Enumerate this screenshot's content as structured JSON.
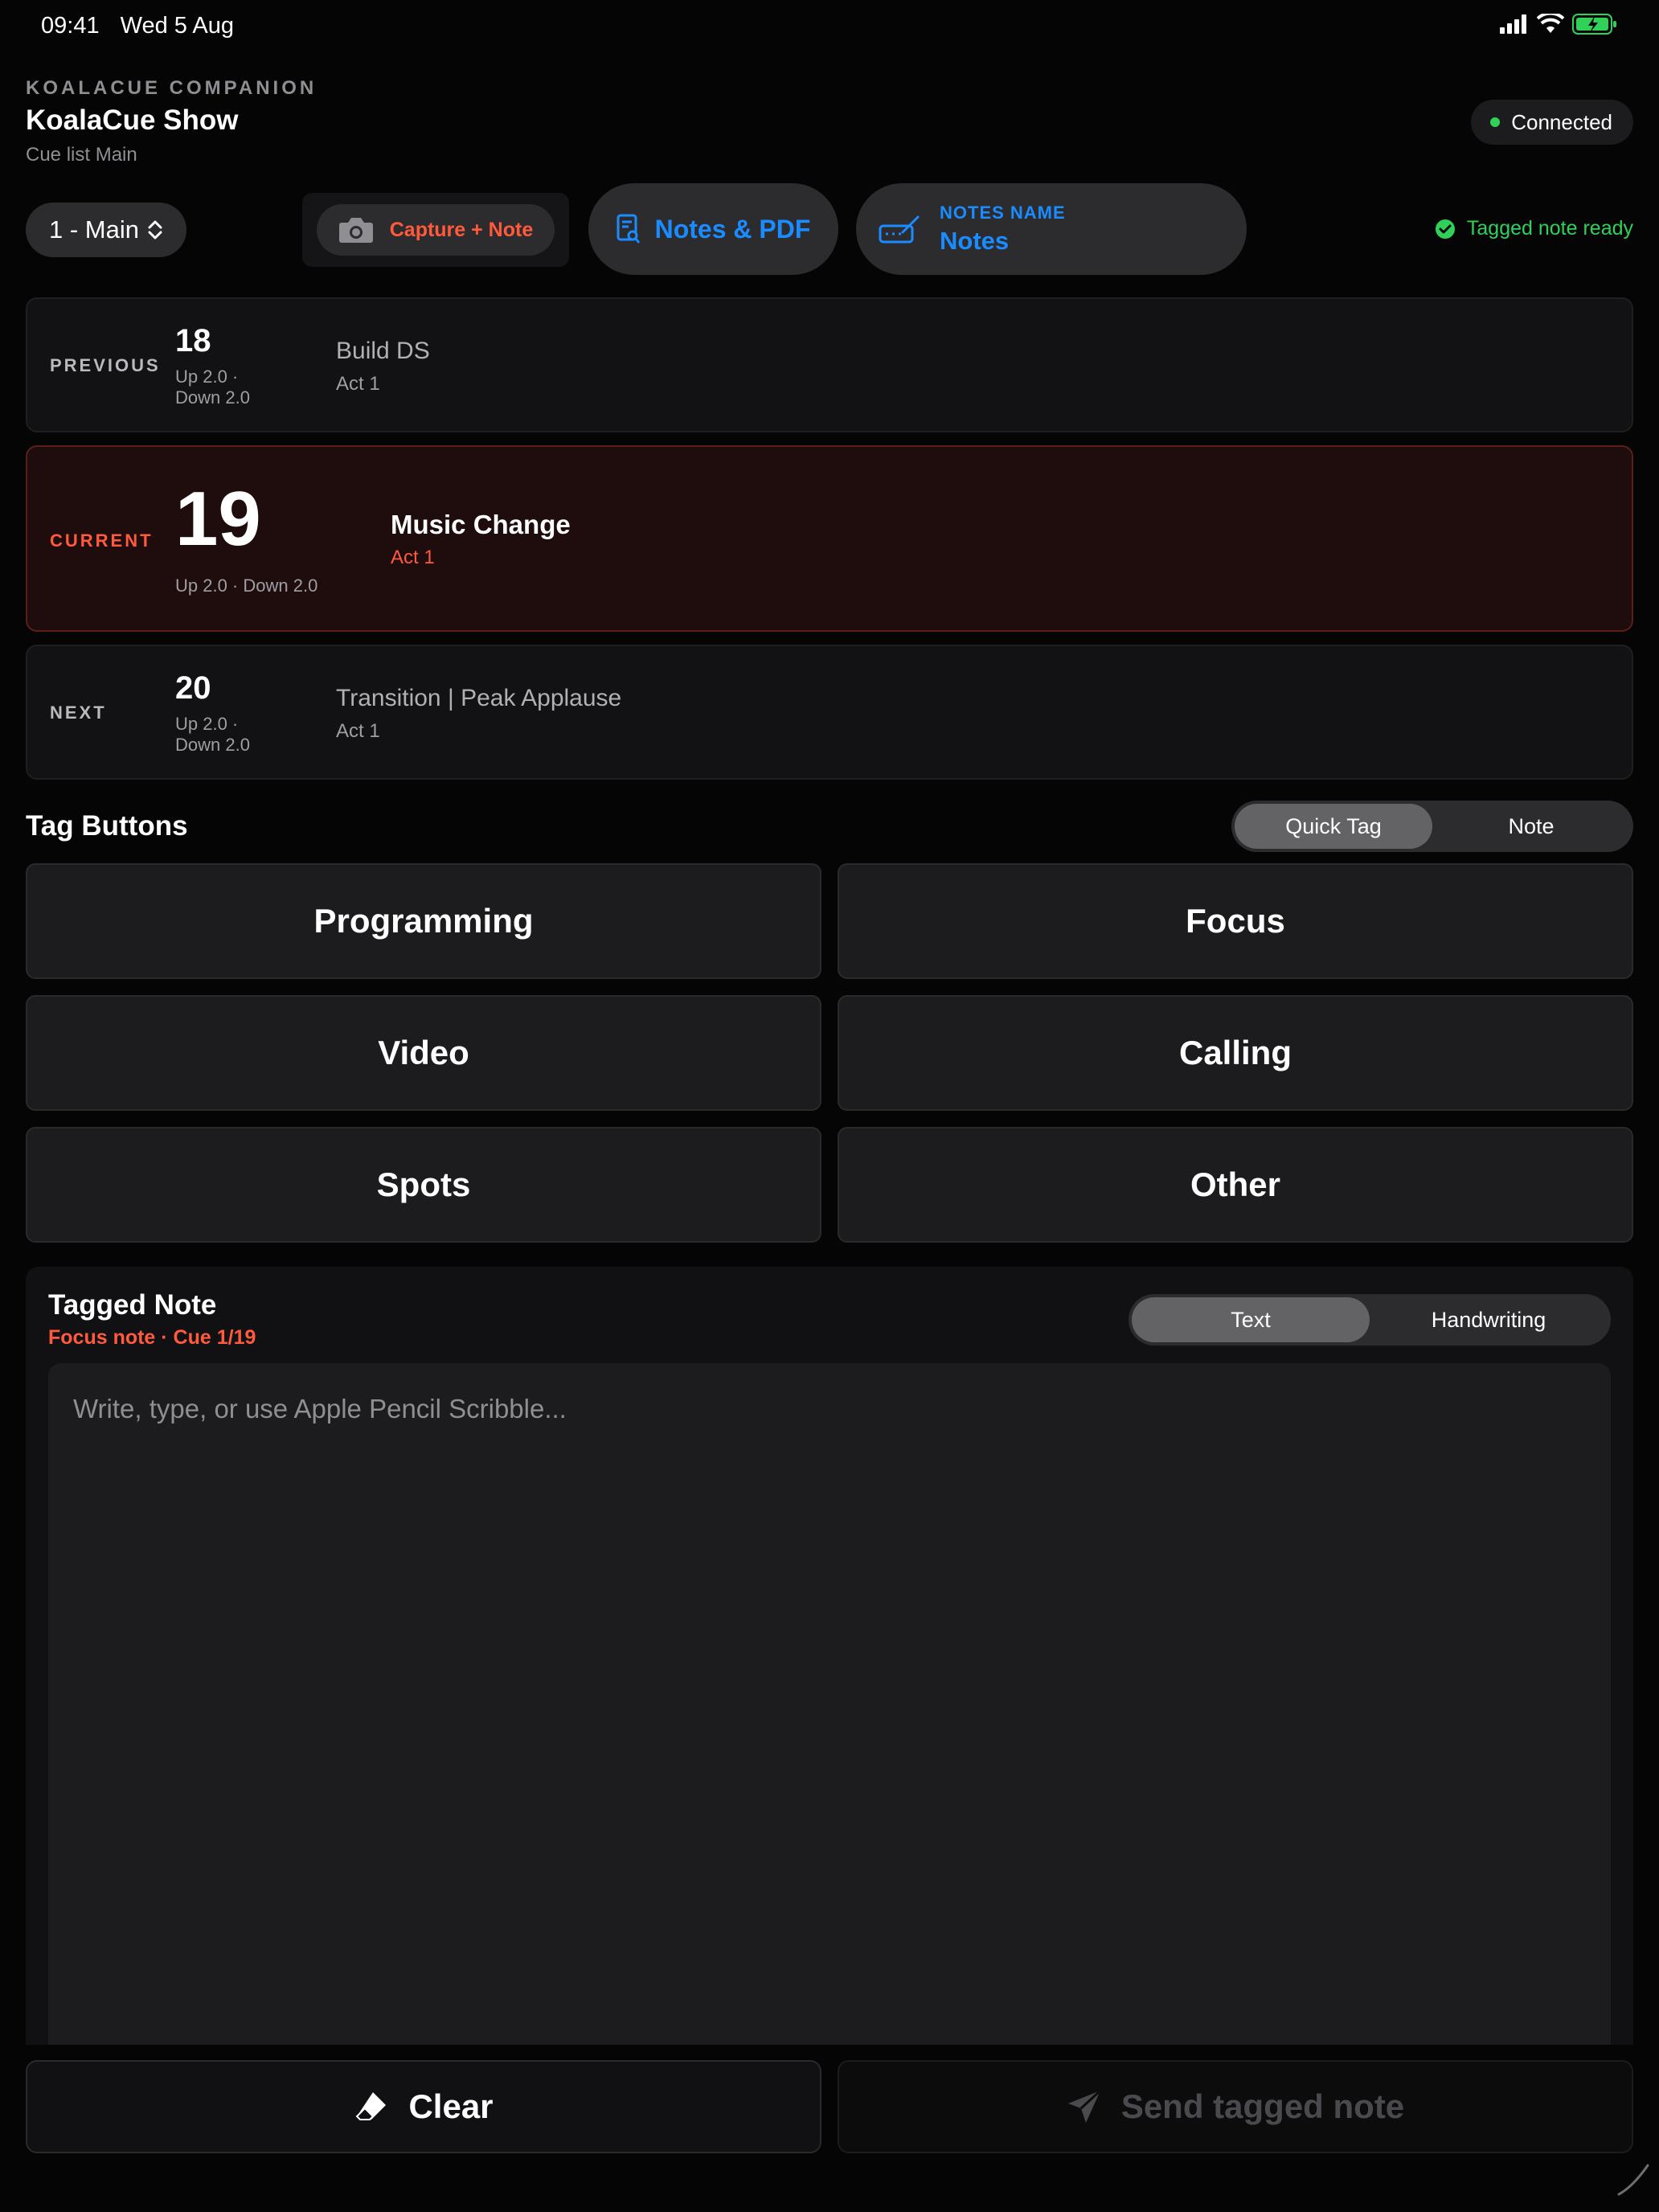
{
  "status_bar": {
    "time": "09:41",
    "date": "Wed 5 Aug"
  },
  "header": {
    "kicker": "KOALACUE COMPANION",
    "title": "KoalaCue Show",
    "subtitle": "Cue list Main",
    "connection": "Connected"
  },
  "toolbar": {
    "cue_list": "1 - Main",
    "capture_label": "Capture + Note",
    "notes_pdf_label": "Notes & PDF",
    "notes_name_kicker": "NOTES NAME",
    "notes_name_value": "Notes",
    "tag_status": "Tagged note ready"
  },
  "cues": {
    "previous": {
      "label": "PREVIOUS",
      "number": "18",
      "meta_1": "Up 2.0 ·",
      "meta_2": "Down 2.0",
      "name": "Build DS",
      "act": "Act 1"
    },
    "current": {
      "label": "CURRENT",
      "number": "19",
      "meta": "Up 2.0 · Down 2.0",
      "name": "Music Change",
      "act": "Act 1"
    },
    "next": {
      "label": "NEXT",
      "number": "20",
      "meta_1": "Up 2.0 ·",
      "meta_2": "Down 2.0",
      "name": "Transition | Peak Applause",
      "act": "Act 1"
    }
  },
  "tags": {
    "title": "Tag Buttons",
    "mode_options": [
      "Quick Tag",
      "Note"
    ],
    "mode_selected": "Quick Tag",
    "buttons": [
      "Programming",
      "Focus",
      "Video",
      "Calling",
      "Spots",
      "Other"
    ]
  },
  "tagged_note": {
    "title": "Tagged Note",
    "subtitle": "Focus note · Cue 1/19",
    "input_options": [
      "Text",
      "Handwriting"
    ],
    "input_selected": "Text",
    "placeholder": "Write, type, or use Apple Pencil Scribble...",
    "value": ""
  },
  "actions": {
    "clear_label": "Clear",
    "send_label": "Send tagged note"
  },
  "colors": {
    "accent_blue": "#1a8cff",
    "accent_red": "#ff5a3c",
    "connected_green": "#30d158",
    "background": "#050506"
  }
}
